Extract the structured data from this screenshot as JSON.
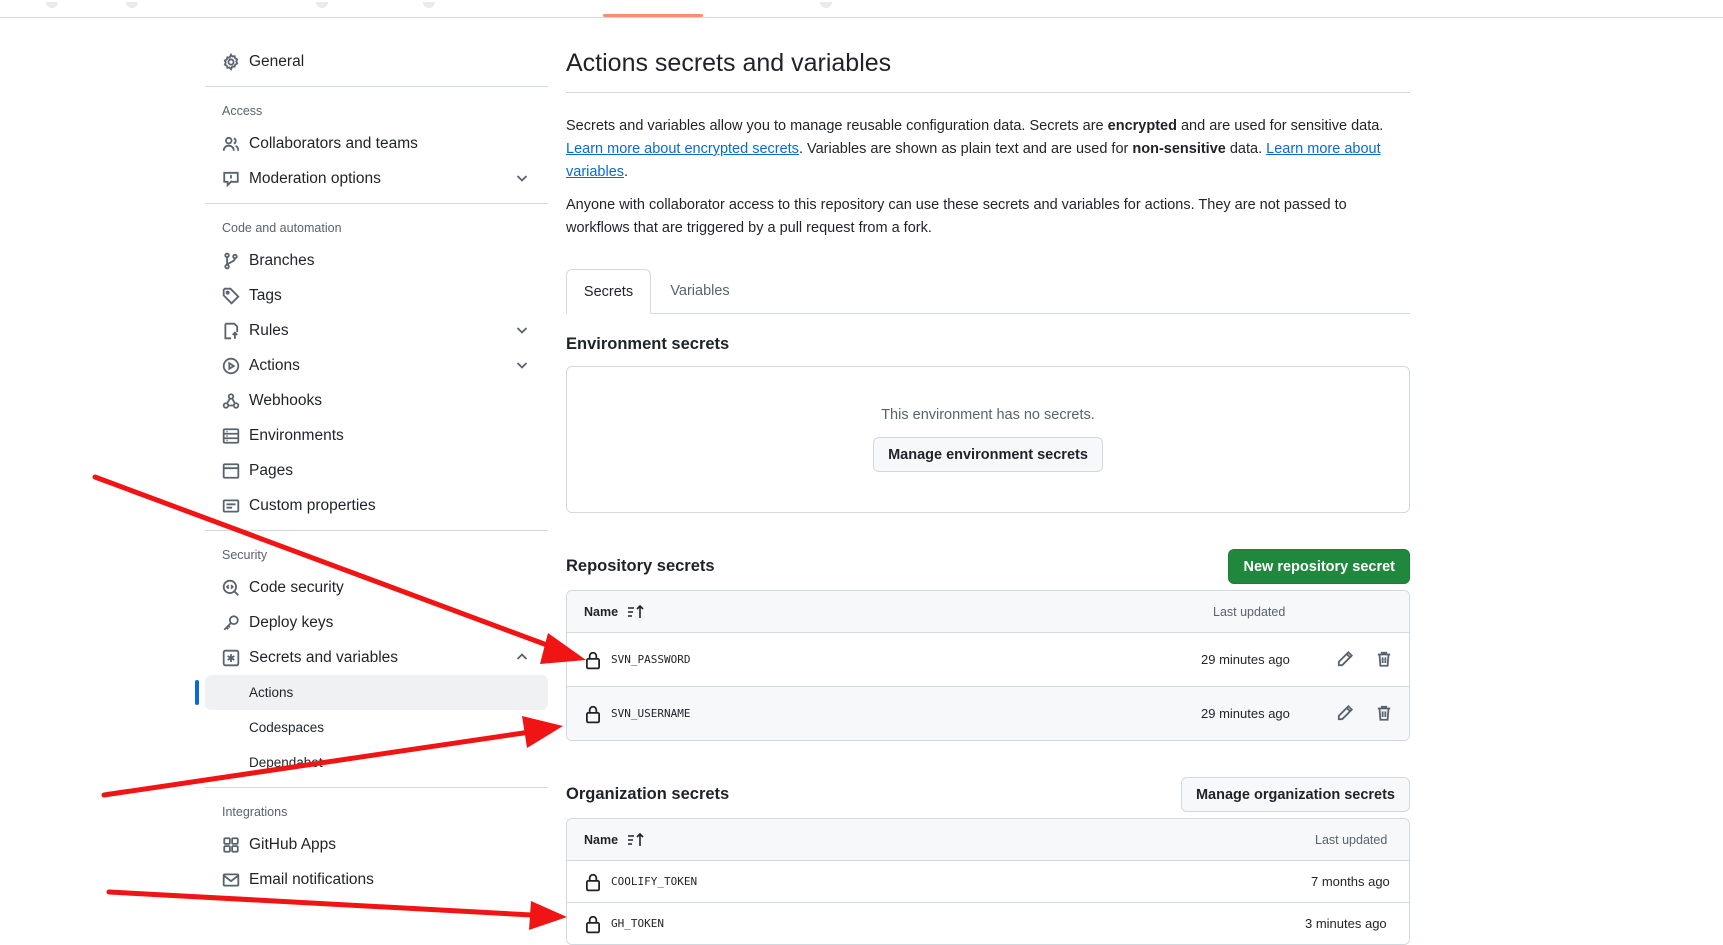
{
  "sidebar": {
    "general": "General",
    "access_heading": "Access",
    "access_items": [
      "Collaborators and teams",
      "Moderation options"
    ],
    "code_heading": "Code and automation",
    "code_items": [
      "Branches",
      "Tags",
      "Rules",
      "Actions",
      "Webhooks",
      "Environments",
      "Pages",
      "Custom properties"
    ],
    "security_heading": "Security",
    "security_items": [
      "Code security",
      "Deploy keys",
      "Secrets and variables"
    ],
    "secrets_sub": [
      "Actions",
      "Codespaces",
      "Dependabot"
    ],
    "integrations_heading": "Integrations",
    "integrations_items": [
      "GitHub Apps",
      "Email notifications"
    ]
  },
  "main": {
    "title": "Actions secrets and variables",
    "desc1_a": "Secrets and variables allow you to manage reusable configuration data. Secrets are ",
    "desc1_b": "encrypted",
    "desc1_c": " and are used for sensitive data. ",
    "desc1_link1": "Learn more about encrypted secrets",
    "desc1_d": ". Variables are shown as plain text and are used for ",
    "desc1_e": "non-sensitive",
    "desc1_f": " data. ",
    "desc1_link2": "Learn more about variables",
    "desc1_g": ".",
    "desc2": "Anyone with collaborator access to this repository can use these secrets and variables for actions. They are not passed to workflows that are triggered by a pull request from a fork.",
    "tabs": [
      "Secrets",
      "Variables"
    ],
    "env_title": "Environment secrets",
    "env_empty": "This environment has no secrets.",
    "env_button": "Manage environment secrets",
    "repo_title": "Repository secrets",
    "repo_button": "New repository secret",
    "col_name": "Name",
    "col_updated": "Last updated",
    "repo_secrets": [
      {
        "name": "SVN_PASSWORD",
        "updated": "29 minutes ago"
      },
      {
        "name": "SVN_USERNAME",
        "updated": "29 minutes ago"
      }
    ],
    "org_title": "Organization secrets",
    "org_button": "Manage organization secrets",
    "org_secrets": [
      {
        "name": "COOLIFY_TOKEN",
        "updated": "7 months ago"
      },
      {
        "name": "GH_TOKEN",
        "updated": "3 minutes ago"
      }
    ]
  },
  "colors": {
    "accent": "#0969da",
    "primary_button": "#1f883d",
    "annotation_arrow": "#f01414"
  },
  "icons": [
    "gear-icon",
    "people-icon",
    "report-icon",
    "git-branch-icon",
    "tag-icon",
    "rules-icon",
    "play-icon",
    "webhook-icon",
    "server-icon",
    "browser-icon",
    "note-icon",
    "codescan-icon",
    "key-icon",
    "asterisk-icon",
    "apps-icon",
    "mail-icon",
    "lock-icon",
    "pencil-icon",
    "trash-icon",
    "sort-icon",
    "chevron-down-icon",
    "chevron-up-icon"
  ]
}
